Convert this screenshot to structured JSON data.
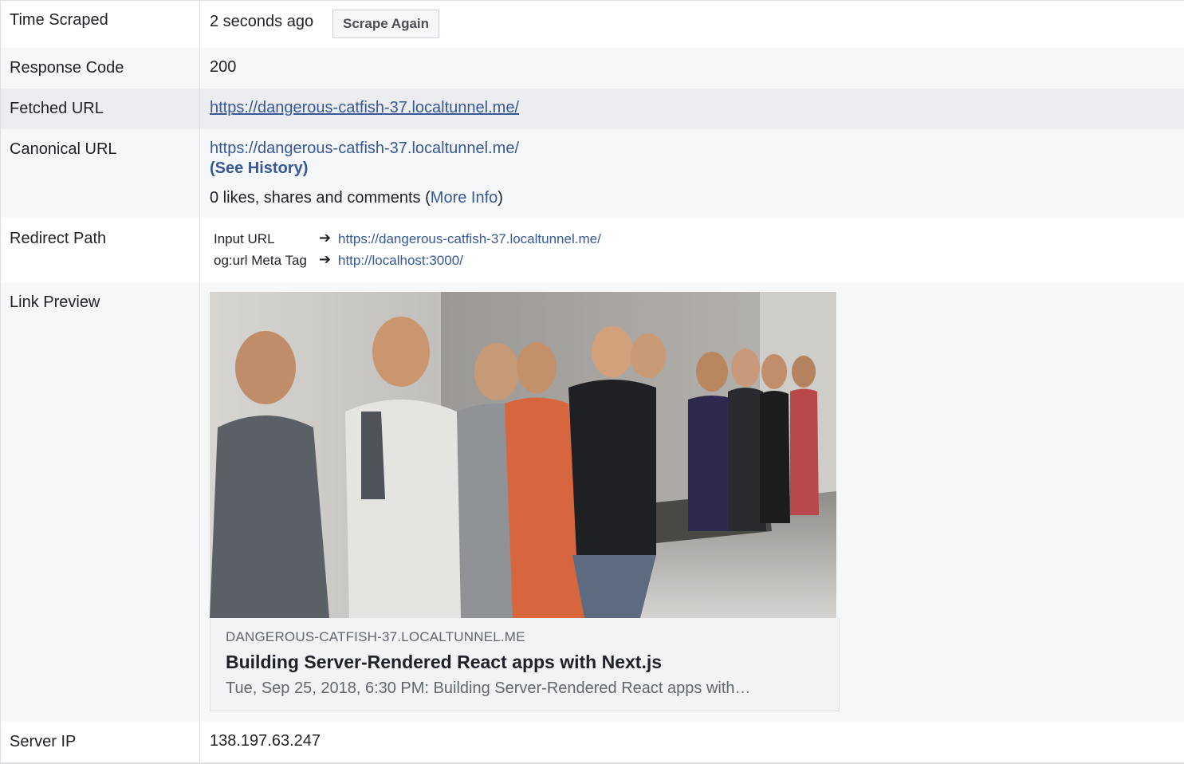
{
  "rows": {
    "time_scraped": {
      "label": "Time Scraped",
      "value": "2 seconds ago",
      "button": "Scrape Again"
    },
    "response_code": {
      "label": "Response Code",
      "value": "200"
    },
    "fetched_url": {
      "label": "Fetched URL",
      "value": "https://dangerous-catfish-37.localtunnel.me/"
    },
    "canonical_url": {
      "label": "Canonical URL",
      "value": "https://dangerous-catfish-37.localtunnel.me/",
      "history": "(See History)",
      "engagement_prefix": "0 likes, shares and comments (",
      "more_info": "More Info",
      "engagement_suffix": ")"
    },
    "redirect_path": {
      "label": "Redirect Path",
      "steps": [
        {
          "name": "Input URL",
          "arrow": "➔",
          "url": "https://dangerous-catfish-37.localtunnel.me/"
        },
        {
          "name": "og:url Meta Tag",
          "arrow": "➔",
          "url": "http://localhost:3000/"
        }
      ]
    },
    "link_preview": {
      "label": "Link Preview",
      "domain": "DANGEROUS-CATFISH-37.LOCALTUNNEL.ME",
      "title": "Building Server-Rendered React apps with Next.js",
      "description": "Tue, Sep 25, 2018, 6:30 PM: Building Server-Rendered React apps with…"
    },
    "server_ip": {
      "label": "Server IP",
      "value": "138.197.63.247"
    }
  },
  "colors": {
    "link": "#365899",
    "row_grey": "#f6f7f9",
    "row_highlight": "#ebedf0",
    "border": "#dddfe2"
  }
}
